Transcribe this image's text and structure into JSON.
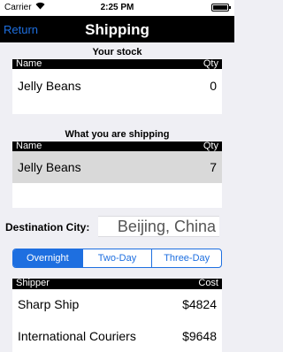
{
  "status_bar": {
    "carrier": "Carrier",
    "time": "2:25 PM",
    "battery_level": 1.0
  },
  "navbar": {
    "back_label": "Return",
    "title": "Shipping"
  },
  "stock": {
    "title": "Your stock",
    "columns": [
      "Name",
      "Qty"
    ],
    "rows": [
      {
        "name": "Jelly Beans",
        "qty": "0"
      }
    ]
  },
  "shipping": {
    "title": "What you are shipping",
    "columns": [
      "Name",
      "Qty"
    ],
    "rows": [
      {
        "name": "Jelly Beans",
        "qty": "7",
        "selected": true
      }
    ]
  },
  "destination": {
    "label": "Destination City:",
    "value": "Beijing, China"
  },
  "speed": {
    "options": [
      "Overnight",
      "Two-Day",
      "Three-Day"
    ],
    "selected": "Overnight"
  },
  "shippers": {
    "columns": [
      "Shipper",
      "Cost"
    ],
    "rows": [
      {
        "name": "Sharp Ship",
        "cost": "$4824"
      },
      {
        "name": "International Couriers",
        "cost": "$9648"
      }
    ]
  },
  "colors": {
    "accent": "#1e6fe0",
    "navbar": "#000000",
    "selected_row": "#d9d9d9",
    "background": "#efeff4"
  }
}
